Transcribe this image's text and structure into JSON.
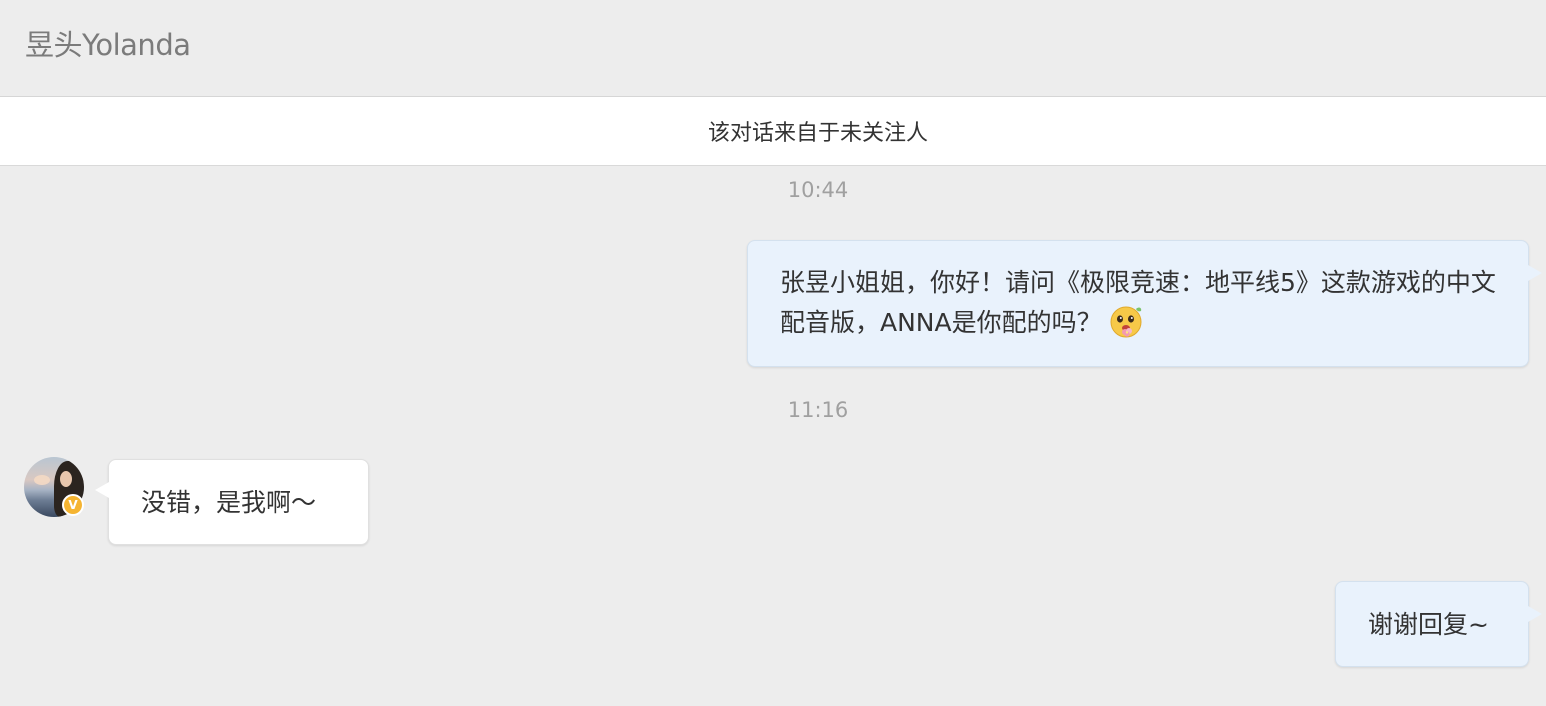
{
  "header": {
    "title": "昱头Yolanda"
  },
  "notice": {
    "text": "该对话来自于未关注人"
  },
  "conversation": {
    "timestamps": [
      "10:44",
      "11:16"
    ],
    "messages": [
      {
        "direction": "outgoing",
        "text": "张昱小姐姐，你好！请问《极限竞速：地平线5》这款游戏的中文配音版，ANNA是你配的吗？",
        "emoji": "flower-face-emoji-icon"
      },
      {
        "direction": "incoming",
        "text": "没错，是我啊～"
      },
      {
        "direction": "outgoing",
        "text": "谢谢回复~"
      }
    ],
    "sender": {
      "avatar_icon": "user-avatar-icon",
      "badge_text": "V",
      "badge_color": "#f5b431"
    }
  },
  "colors": {
    "background": "#ededed",
    "outgoing_bubble": "#e9f2fc",
    "incoming_bubble": "#ffffff",
    "text": "#333333",
    "timestamp": "#a0a0a0"
  }
}
